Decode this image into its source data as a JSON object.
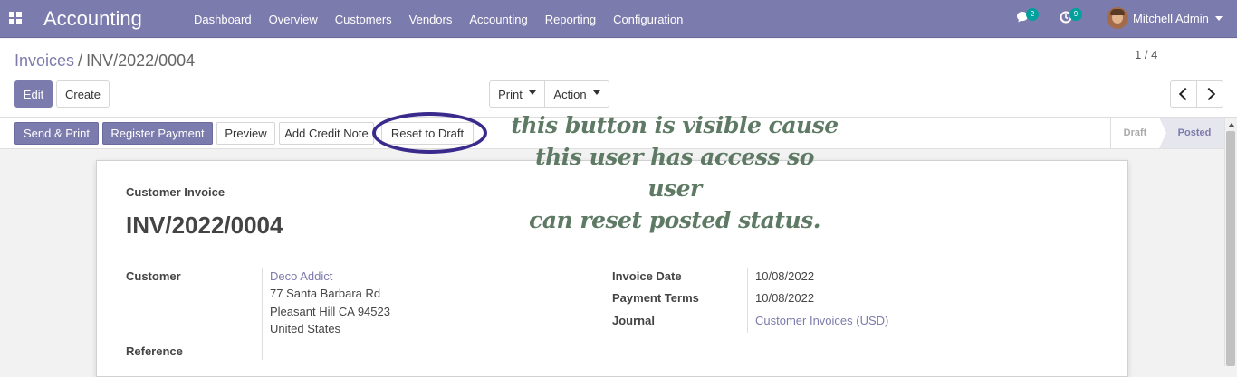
{
  "navbar": {
    "app_title": "Accounting",
    "menu": [
      "Dashboard",
      "Overview",
      "Customers",
      "Vendors",
      "Accounting",
      "Reporting",
      "Configuration"
    ],
    "messages_badge": "2",
    "activities_badge": "9",
    "user_name": "Mitchell Admin"
  },
  "breadcrumb": {
    "parent": "Invoices",
    "separator": "/",
    "current": "INV/2022/0004"
  },
  "control": {
    "edit_label": "Edit",
    "create_label": "Create",
    "print_label": "Print",
    "action_label": "Action",
    "pager": "1 / 4"
  },
  "statusbar": {
    "send_print": "Send & Print",
    "register_payment": "Register Payment",
    "preview": "Preview",
    "add_credit_note": "Add Credit Note",
    "reset_to_draft": "Reset to Draft",
    "stages": [
      "Draft",
      "Posted"
    ],
    "active_stage": "Posted"
  },
  "invoice": {
    "type": "Customer Invoice",
    "name": "INV/2022/0004",
    "customer_label": "Customer",
    "customer_name": "Deco Addict",
    "address_line1": "77 Santa Barbara Rd",
    "address_line2": "Pleasant Hill CA 94523",
    "address_line3": "United States",
    "reference_label": "Reference",
    "invoice_date_label": "Invoice Date",
    "invoice_date": "10/08/2022",
    "payment_terms_label": "Payment Terms",
    "payment_terms": "10/08/2022",
    "journal_label": "Journal",
    "journal": "Customer Invoices (USD)"
  },
  "annotation": {
    "line1": "this button is visible cause",
    "line2": "this user has access so user",
    "line3": "can reset posted status."
  },
  "colors": {
    "brand": "#7c7bad",
    "annotation_text": "#5e7a64",
    "highlight_ellipse": "#3a2a8c"
  }
}
